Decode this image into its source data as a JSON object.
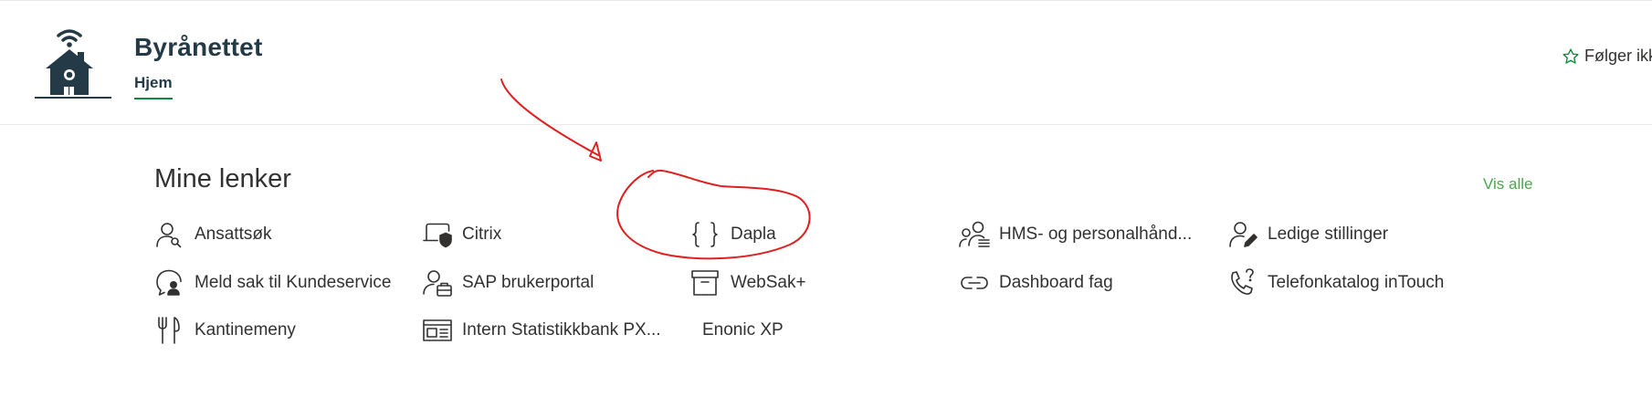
{
  "header": {
    "site_title": "Byrånettet",
    "nav_home": "Hjem",
    "follow_label": "Følger ikk"
  },
  "links_section": {
    "title": "Mine lenker",
    "see_all": "Vis alle",
    "items": [
      {
        "label": "Ansattsøk",
        "icon": "person-search-icon"
      },
      {
        "label": "Meld sak til Kundeservice",
        "icon": "person-chat-icon"
      },
      {
        "label": "Kantinemeny",
        "icon": "fork-knife-icon"
      },
      {
        "label": "Citrix",
        "icon": "laptop-shield-icon"
      },
      {
        "label": "SAP brukerportal",
        "icon": "person-briefcase-icon"
      },
      {
        "label": "Intern Statistikkbank PX...",
        "icon": "window-icon"
      },
      {
        "label": "Dapla",
        "icon": "braces-icon"
      },
      {
        "label": "WebSak+",
        "icon": "archive-icon"
      },
      {
        "label": "Enonic XP",
        "icon": ""
      },
      {
        "label": "HMS- og personalhånd...",
        "icon": "people-list-icon"
      },
      {
        "label": "Dashboard fag",
        "icon": "link-icon"
      },
      {
        "label": "Ledige stillinger",
        "icon": "person-edit-icon"
      },
      {
        "label": "Telefonkatalog inTouch",
        "icon": "phone-question-icon"
      }
    ]
  },
  "colors": {
    "accent_green": "#0b8a3e",
    "see_all_green": "#4aa84a",
    "annotation_red": "#e02020",
    "logo_dark": "#243a46"
  }
}
